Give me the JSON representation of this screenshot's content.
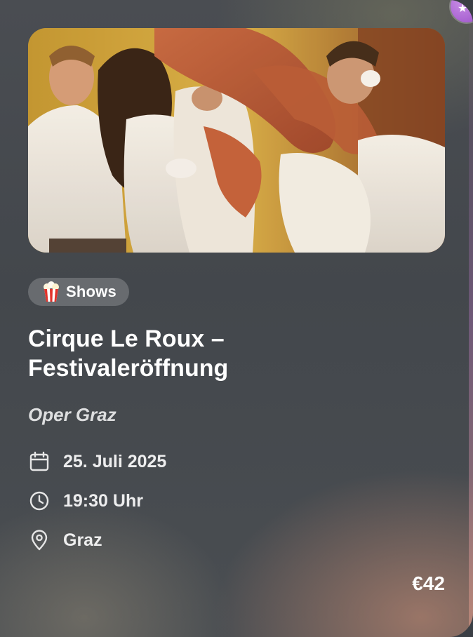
{
  "event": {
    "category_label": "Shows",
    "category_icon": "popcorn-icon",
    "title_line1": "Cirque Le Roux –",
    "title_line2": "Festivaleröffnung",
    "venue": "Oper Graz",
    "date": "25. Juli 2025",
    "time": "19:30 Uhr",
    "location": "Graz",
    "price": "€42"
  },
  "icons": {
    "date": "calendar-icon",
    "time": "clock-icon",
    "location": "map-pin-icon",
    "corner": "star-icon"
  },
  "colors": {
    "card_background": "#474b50",
    "text_primary": "#ffffff",
    "pill_background": "rgba(255,255,255,0.20)",
    "corner_badge": "#b06ad8"
  }
}
